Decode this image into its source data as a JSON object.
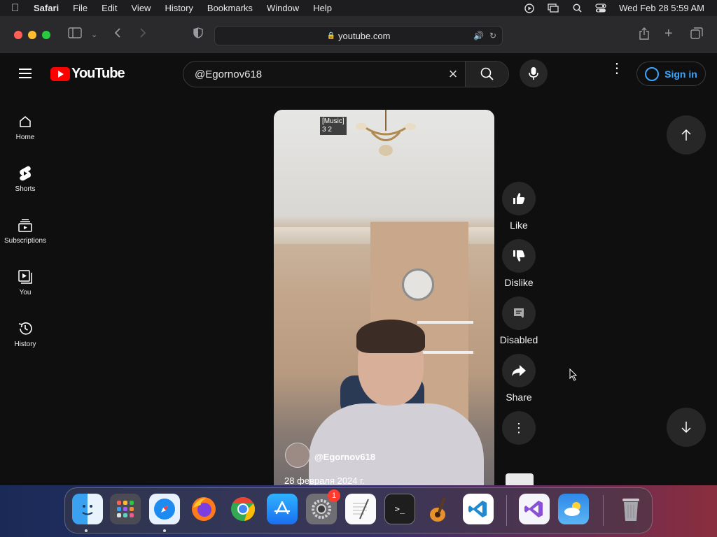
{
  "menubar": {
    "app": "Safari",
    "items": [
      "File",
      "Edit",
      "View",
      "History",
      "Bookmarks",
      "Window",
      "Help"
    ],
    "datetime": "Wed Feb 28  5:59 AM"
  },
  "browser": {
    "url": "youtube.com"
  },
  "youtube": {
    "logo": "YouTube",
    "search_value": "@Egornov618",
    "signin_label": "Sign in",
    "nav": [
      {
        "label": "Home",
        "icon": "home-icon"
      },
      {
        "label": "Shorts",
        "icon": "shorts-icon"
      },
      {
        "label": "Subscriptions",
        "icon": "subscriptions-icon"
      },
      {
        "label": "You",
        "icon": "you-icon"
      },
      {
        "label": "History",
        "icon": "history-icon"
      }
    ],
    "video": {
      "caption_line1": "[Music]",
      "caption_line2": "3 2",
      "channel": "@Egornov618",
      "date": "28 февраля 2024 г."
    },
    "actions": {
      "like": "Like",
      "dislike": "Dislike",
      "comments": "Disabled",
      "share": "Share"
    }
  },
  "dock": {
    "apps": [
      "Finder",
      "Launchpad",
      "Safari",
      "Firefox",
      "Chrome",
      "App Store",
      "System Settings",
      "TextEdit",
      "Terminal",
      "GarageBand",
      "VS Code",
      "Visual Studio",
      "Weather",
      "Trash"
    ],
    "settings_badge": "1"
  },
  "colors": {
    "yt_red": "#ff0000",
    "signin_blue": "#3ea6ff",
    "background": "#0f0f0f"
  }
}
